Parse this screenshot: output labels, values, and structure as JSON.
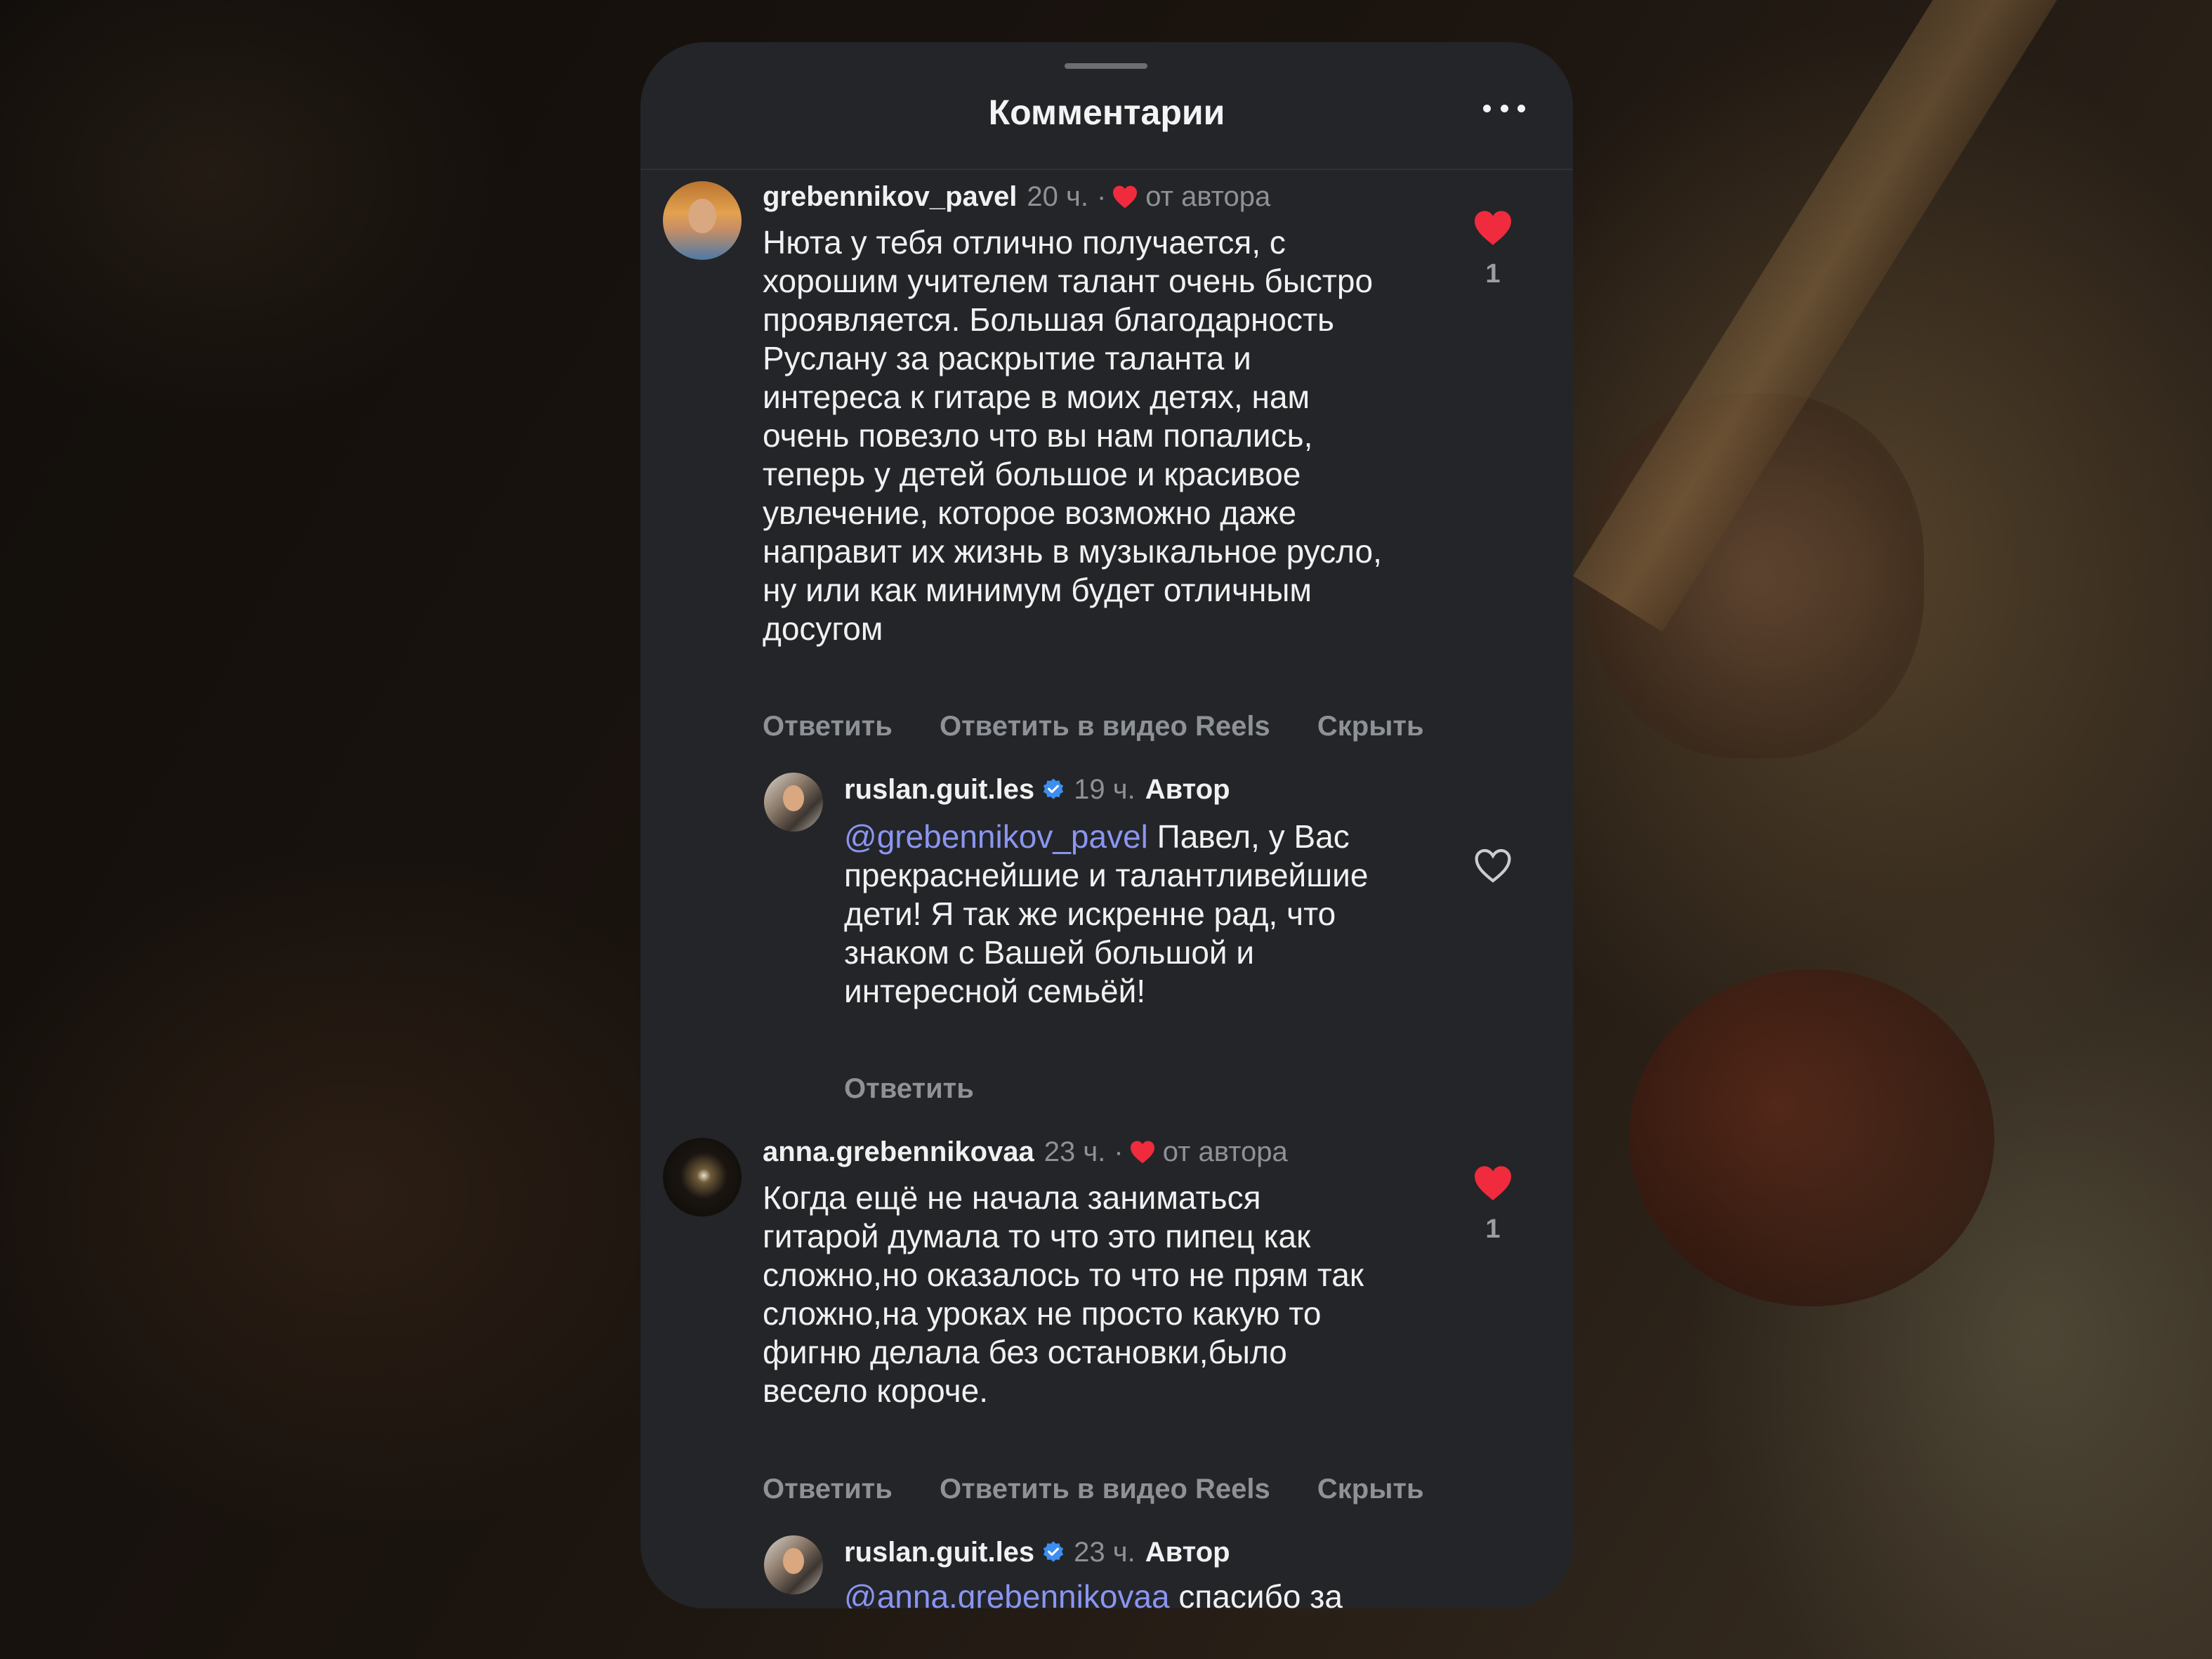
{
  "header": {
    "title": "Комментарии",
    "more_icon": "more-horizontal-icon"
  },
  "colors": {
    "panel": "#232528",
    "text": "#f1f1f1",
    "muted": "#8e9196",
    "mention": "#8b95f0",
    "like": "#ef2b3d",
    "verified": "#3d8ef0"
  },
  "comments": [
    {
      "username": "grebennikov_pavel",
      "time": "20 ч.",
      "separator": "·",
      "liked_by_author": "от автора",
      "text": "Нюта у тебя отлично получается, с\nхорошим учителем талант очень быстро\nпроявляется. Большая благодарность\nРуслану за раскрытие таланта и\nинтереса к гитаре в моих детях, нам\nочень повезло что вы нам попались,\nтеперь у детей большое и красивое\nувлечение, которое возможно даже\nнаправит их жизнь в музыкальное русло,\nну или как минимум будет отличным\nдосугом",
      "actions": [
        "Ответить",
        "Ответить в видео Reels",
        "Скрыть"
      ],
      "likes": "1",
      "liked": true
    },
    {
      "username": "ruslan.guit.les",
      "verified": true,
      "time": "19 ч.",
      "author_label": "Автор",
      "mention": "@grebennikov_pavel",
      "text": " Павел, у Вас\nпрекраснейшие и талантливейшие\nдети! Я так же искренне рад, что\nзнаком с Вашей большой и\nинтересной семьёй!",
      "actions": [
        "Ответить"
      ],
      "liked": false
    },
    {
      "username": "anna.grebennikovaa",
      "time": "23 ч.",
      "separator": "·",
      "liked_by_author": "от автора",
      "text": "Когда ещё не начала заниматься\nгитарой думала то что это пипец как\nсложно,но оказалось то что не прям так\nсложно,на уроках не просто какую то\nфигню делала без остановки,было\nвесело короче.",
      "actions": [
        "Ответить",
        "Ответить в видео Reels",
        "Скрыть"
      ],
      "likes": "1",
      "liked": true
    },
    {
      "username": "ruslan.guit.les",
      "verified": true,
      "time": "23 ч.",
      "author_label": "Автор",
      "mention": "@anna.grebennikovaa",
      "text": " спасибо за",
      "liked": false
    }
  ]
}
